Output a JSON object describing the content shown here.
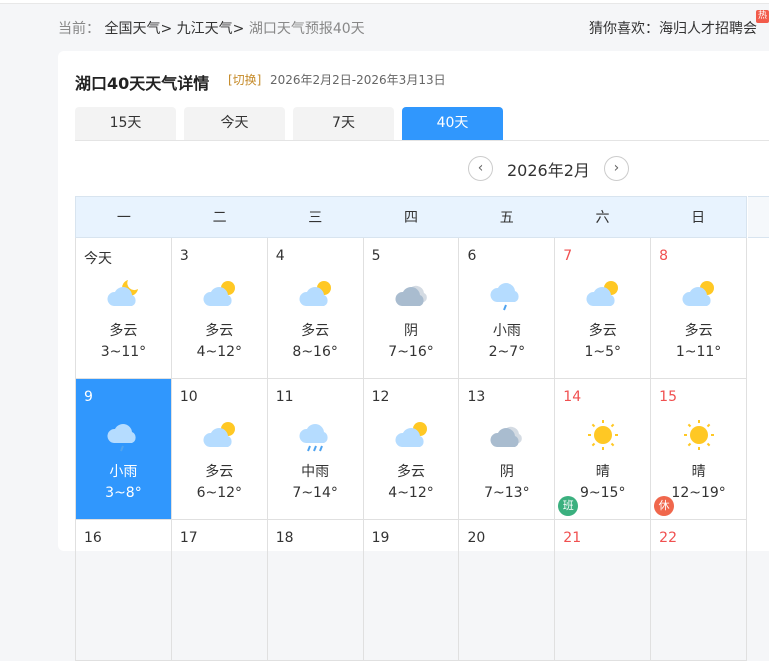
{
  "breadcrumb": {
    "prefix": "当前：",
    "items": [
      "全国天气>",
      "九江天气>"
    ],
    "current": "湖口天气预报40天"
  },
  "guess": {
    "label": "猜你喜欢：",
    "link": "海归人才招聘会",
    "hot": "热"
  },
  "header": {
    "title": "湖口40天天气详情",
    "switch": "[切换]",
    "range": "2026年2月2日-2026年3月13日"
  },
  "tabs": [
    {
      "label": "15天"
    },
    {
      "label": "今天"
    },
    {
      "label": "7天"
    },
    {
      "label": "40天",
      "active": true
    }
  ],
  "month": {
    "label": "2026年2月",
    "prev": "‹",
    "next": "›"
  },
  "weekdays": [
    "一",
    "二",
    "三",
    "四",
    "五",
    "六",
    "日"
  ],
  "colors": {
    "accent": "#3097fd",
    "weekend": "#f05050",
    "work_badge": "#3bb07f",
    "rest_badge": "#f0674c"
  },
  "days": [
    {
      "d": "今天",
      "icon": "cloud-moon",
      "w": "多云",
      "t": "3~11°"
    },
    {
      "d": "3",
      "icon": "cloud-sun",
      "w": "多云",
      "t": "4~12°"
    },
    {
      "d": "4",
      "icon": "cloud-sun",
      "w": "多云",
      "t": "8~16°"
    },
    {
      "d": "5",
      "icon": "overcast",
      "w": "阴",
      "t": "7~16°"
    },
    {
      "d": "6",
      "icon": "light-rain",
      "w": "小雨",
      "t": "2~7°"
    },
    {
      "d": "7",
      "icon": "cloud-sun",
      "w": "多云",
      "t": "1~5°",
      "red": true
    },
    {
      "d": "8",
      "icon": "cloud-sun",
      "w": "多云",
      "t": "1~11°",
      "red": true
    },
    {
      "d": "9",
      "icon": "light-rain",
      "w": "小雨",
      "t": "3~8°",
      "sel": true
    },
    {
      "d": "10",
      "icon": "cloud-sun",
      "w": "多云",
      "t": "6~12°"
    },
    {
      "d": "11",
      "icon": "moderate-rain",
      "w": "中雨",
      "t": "7~14°"
    },
    {
      "d": "12",
      "icon": "cloud-sun",
      "w": "多云",
      "t": "4~12°"
    },
    {
      "d": "13",
      "icon": "overcast",
      "w": "阴",
      "t": "7~13°"
    },
    {
      "d": "14",
      "icon": "sun",
      "w": "晴",
      "t": "9~15°",
      "red": true,
      "badge": "班"
    },
    {
      "d": "15",
      "icon": "sun",
      "w": "晴",
      "t": "12~19°",
      "red": true,
      "badge": "休"
    },
    {
      "d": "16"
    },
    {
      "d": "17"
    },
    {
      "d": "18"
    },
    {
      "d": "19"
    },
    {
      "d": "20"
    },
    {
      "d": "21",
      "red": true
    },
    {
      "d": "22",
      "red": true
    }
  ]
}
